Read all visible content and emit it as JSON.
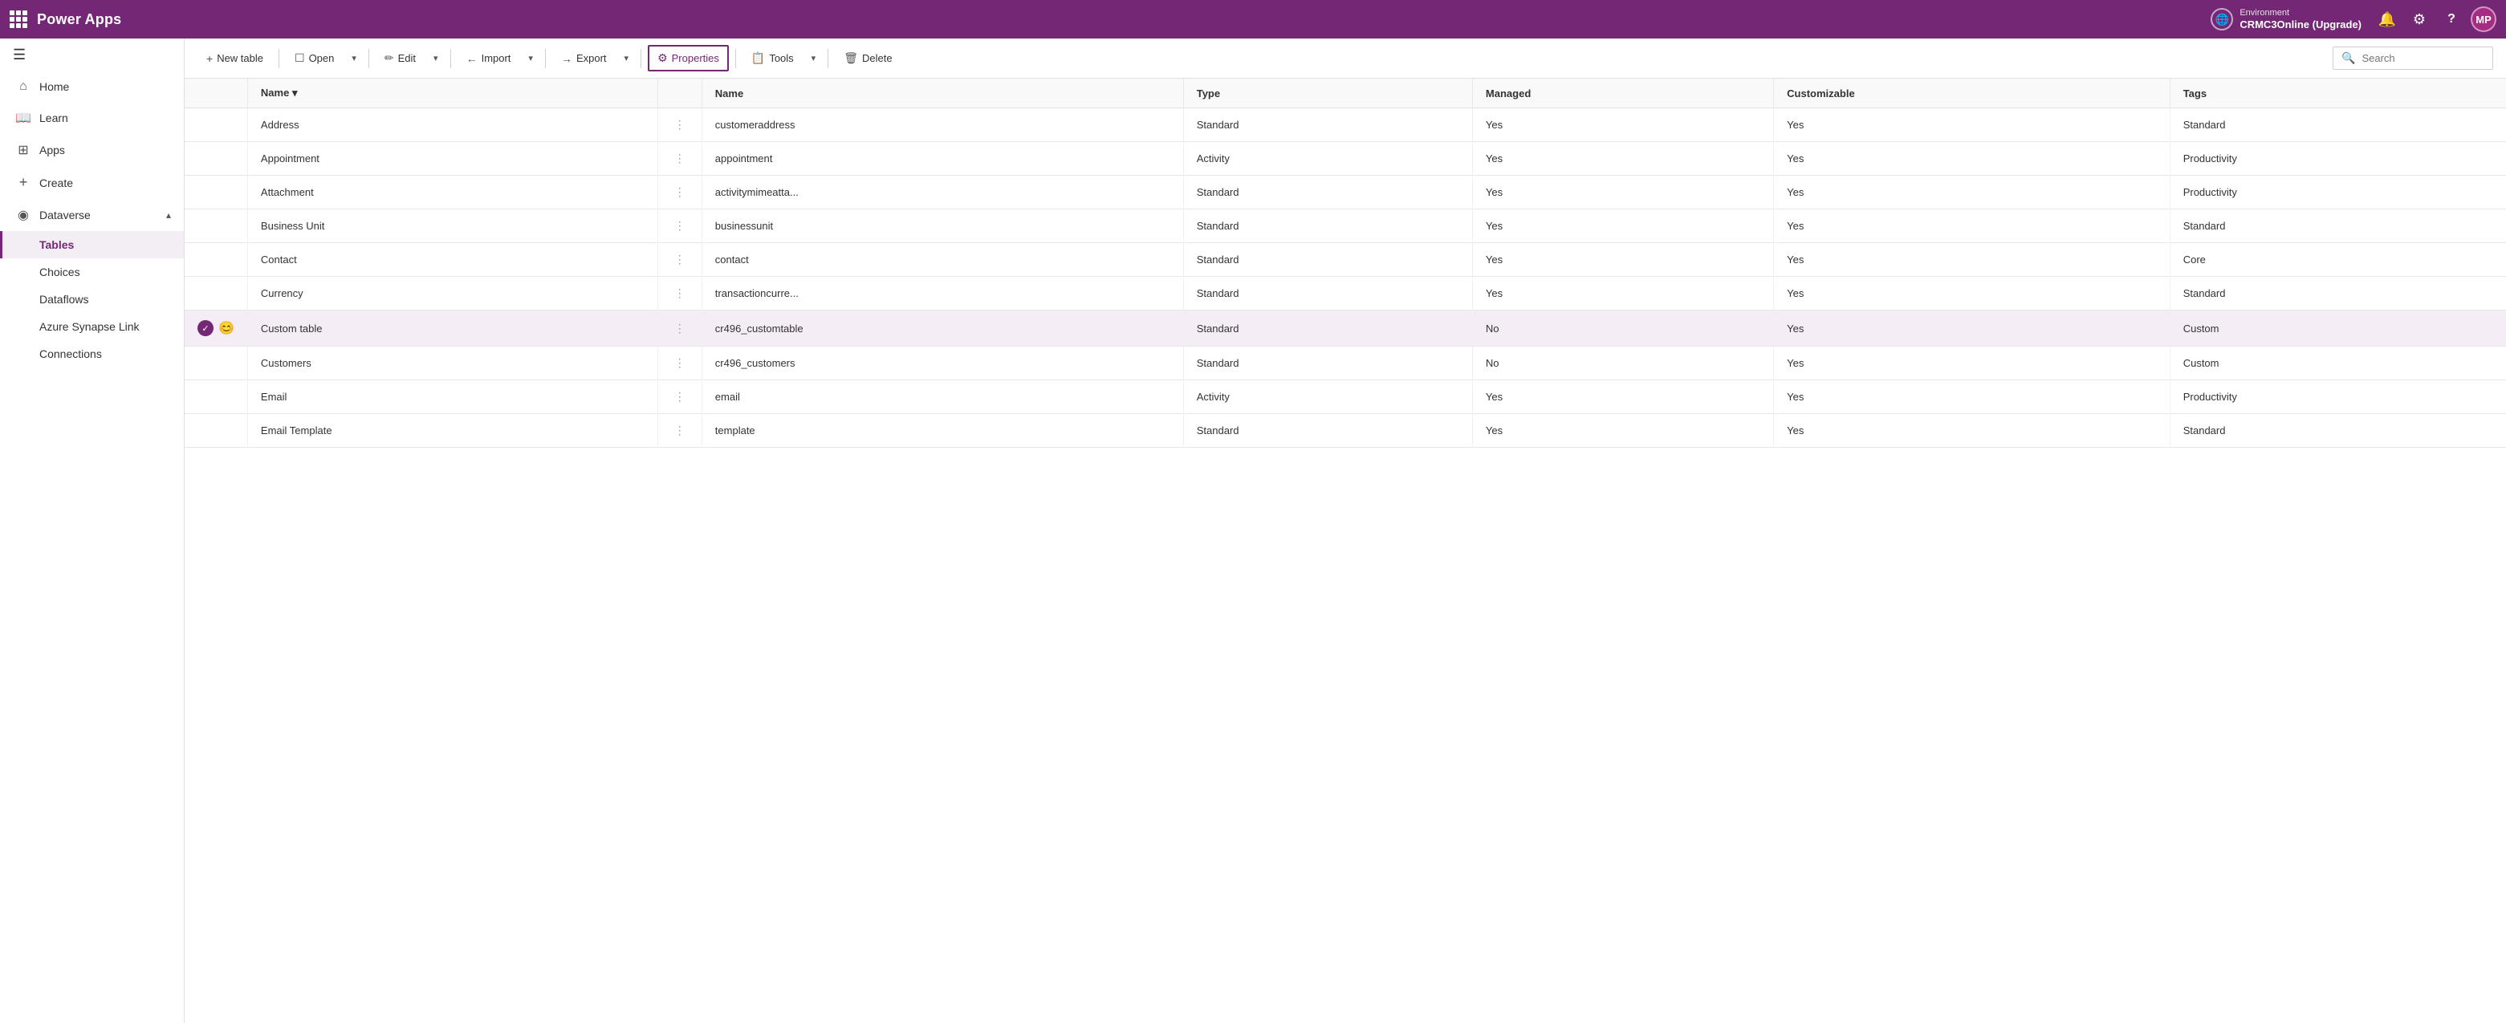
{
  "app": {
    "waffle_title": "Power Apps",
    "env_label": "Environment",
    "env_name": "CRMC3Online (Upgrade)"
  },
  "sidebar": {
    "toggle_icon": "☰",
    "items": [
      {
        "id": "home",
        "label": "Home",
        "icon": "⌂"
      },
      {
        "id": "learn",
        "label": "Learn",
        "icon": "📖"
      },
      {
        "id": "apps",
        "label": "Apps",
        "icon": "⊞"
      },
      {
        "id": "create",
        "label": "Create",
        "icon": "+"
      },
      {
        "id": "dataverse",
        "label": "Dataverse",
        "icon": "◉",
        "expandable": true
      }
    ],
    "sub_items": [
      {
        "id": "tables",
        "label": "Tables",
        "active": true
      },
      {
        "id": "choices",
        "label": "Choices"
      },
      {
        "id": "dataflows",
        "label": "Dataflows"
      },
      {
        "id": "azure-synapse-link",
        "label": "Azure Synapse Link"
      },
      {
        "id": "connections",
        "label": "Connections"
      }
    ]
  },
  "toolbar": {
    "new_table": "New table",
    "open": "Open",
    "edit": "Edit",
    "import": "Import",
    "export": "Export",
    "properties": "Properties",
    "tools": "Tools",
    "delete": "Delete",
    "search_placeholder": "Search"
  },
  "table": {
    "columns": [
      {
        "id": "row-selector",
        "label": ""
      },
      {
        "id": "name",
        "label": "Name"
      },
      {
        "id": "menu",
        "label": ""
      },
      {
        "id": "name-value",
        "label": "Name"
      },
      {
        "id": "type",
        "label": "Type"
      },
      {
        "id": "managed",
        "label": "Managed"
      },
      {
        "id": "customizable",
        "label": "Customizable"
      },
      {
        "id": "tags",
        "label": "Tags"
      }
    ],
    "rows": [
      {
        "id": "address",
        "name": "Address",
        "name_value": "customeraddress",
        "type": "Standard",
        "managed": "Yes",
        "customizable": "Yes",
        "tags": "Standard",
        "selected": false
      },
      {
        "id": "appointment",
        "name": "Appointment",
        "name_value": "appointment",
        "type": "Activity",
        "managed": "Yes",
        "customizable": "Yes",
        "tags": "Productivity",
        "selected": false
      },
      {
        "id": "attachment",
        "name": "Attachment",
        "name_value": "activitymimeatta...",
        "type": "Standard",
        "managed": "Yes",
        "customizable": "Yes",
        "tags": "Productivity",
        "selected": false
      },
      {
        "id": "business-unit",
        "name": "Business Unit",
        "name_value": "businessunit",
        "type": "Standard",
        "managed": "Yes",
        "customizable": "Yes",
        "tags": "Standard",
        "selected": false
      },
      {
        "id": "contact",
        "name": "Contact",
        "name_value": "contact",
        "type": "Standard",
        "managed": "Yes",
        "customizable": "Yes",
        "tags": "Core",
        "selected": false
      },
      {
        "id": "currency",
        "name": "Currency",
        "name_value": "transactioncurre...",
        "type": "Standard",
        "managed": "Yes",
        "customizable": "Yes",
        "tags": "Standard",
        "selected": false
      },
      {
        "id": "custom-table",
        "name": "Custom table",
        "name_value": "cr496_customtable",
        "type": "Standard",
        "managed": "No",
        "customizable": "Yes",
        "tags": "Custom",
        "selected": true,
        "has_check": true,
        "has_emoji": true,
        "emoji": "😊"
      },
      {
        "id": "customers",
        "name": "Customers",
        "name_value": "cr496_customers",
        "type": "Standard",
        "managed": "No",
        "customizable": "Yes",
        "tags": "Custom",
        "selected": false
      },
      {
        "id": "email",
        "name": "Email",
        "name_value": "email",
        "type": "Activity",
        "managed": "Yes",
        "customizable": "Yes",
        "tags": "Productivity",
        "selected": false
      },
      {
        "id": "email-template",
        "name": "Email Template",
        "name_value": "template",
        "type": "Standard",
        "managed": "Yes",
        "customizable": "Yes",
        "tags": "Standard",
        "selected": false
      }
    ]
  },
  "icons": {
    "waffle": "⊞",
    "home": "⌂",
    "learn": "📖",
    "apps": "⊞",
    "create": "+",
    "dataverse": "◉",
    "bell": "🔔",
    "gear": "⚙",
    "question": "?",
    "avatar": "MP",
    "globe": "🌐",
    "search": "🔍",
    "new-table": "+",
    "open": "☐",
    "edit": "✏",
    "import": "←",
    "export": "→",
    "properties": "⚙",
    "tools": "📋",
    "delete": "🗑",
    "chevron-down": "▾",
    "chevron-up": "▴"
  }
}
